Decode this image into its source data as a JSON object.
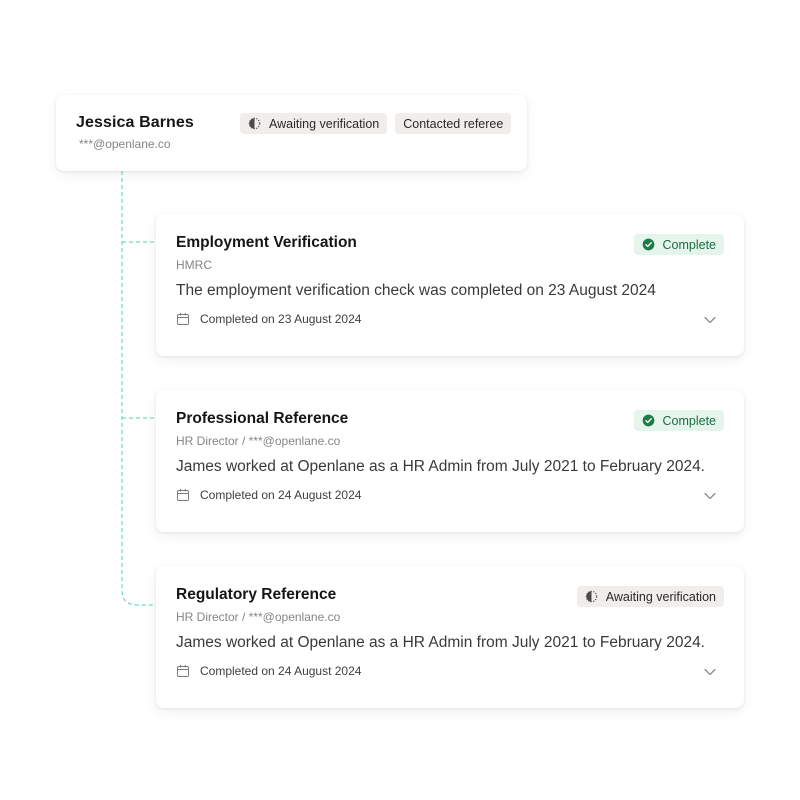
{
  "candidate": {
    "name": "Jessica Barnes",
    "email": "***@openlane.co",
    "badges": [
      {
        "label": "Awaiting verification",
        "icon": "half-circle-icon"
      },
      {
        "label": "Contacted referee"
      }
    ]
  },
  "checks": [
    {
      "title": "Employment Verification",
      "subtitle": "HMRC",
      "description": "The employment verification check was completed on 23 August 2024",
      "date": "Completed on 23 August 2024",
      "status": {
        "label": "Complete",
        "type": "complete",
        "icon": "check-circle-icon"
      }
    },
    {
      "title": "Professional Reference",
      "subtitle": "HR Director / ***@openlane.co",
      "description": "James worked at Openlane as a HR Admin from July 2021 to February 2024.",
      "date": "Completed on 24 August 2024",
      "status": {
        "label": "Complete",
        "type": "complete",
        "icon": "check-circle-icon"
      }
    },
    {
      "title": "Regulatory Reference",
      "subtitle": "HR Director / ***@openlane.co",
      "description": "James worked at Openlane as a HR Admin from July 2021 to February 2024.",
      "date": "Completed on 24 August 2024",
      "status": {
        "label": "Awaiting verification",
        "type": "pending",
        "icon": "half-circle-icon"
      }
    }
  ],
  "colors": {
    "connector": "#4fd3b5",
    "complete_bg": "#e6f5ec",
    "complete_text": "#1b6b3f",
    "complete_icon": "#1f7a46",
    "pending_bg": "#f0edea"
  }
}
